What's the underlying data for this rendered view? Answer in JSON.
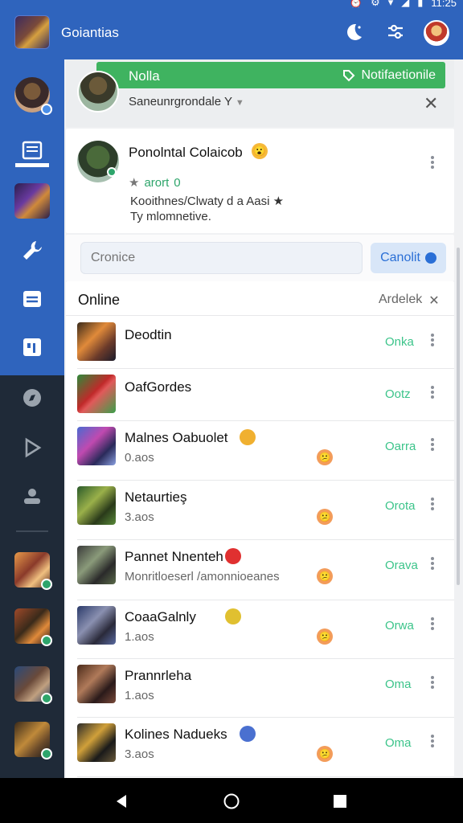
{
  "status_bar": {
    "clock": "11:25"
  },
  "app_bar": {
    "title": "Goiantias"
  },
  "banner": {
    "left": "Nolla",
    "right": "Notifaetionile"
  },
  "header": {
    "server": "Saneunrgrondale",
    "server_caret": "Y"
  },
  "profile": {
    "name": "Ponolntal Colaicob",
    "status_star": "★",
    "status_text": "arort",
    "status_count": "0",
    "bio1": "Kooithnes/Clwaty d a Aasi ★",
    "bio2": "Ty mlomnetive."
  },
  "search": {
    "placeholder": "Cronice"
  },
  "cancel_button": {
    "label": "Canolit"
  },
  "section": {
    "title": "Online",
    "action": "Ardelek"
  },
  "rows": [
    {
      "name": "Deodtin",
      "sub": "",
      "status": "Onka",
      "emoji": ""
    },
    {
      "name": "OafGordes",
      "sub": "",
      "status": "Ootz",
      "emoji": ""
    },
    {
      "name": "Malnes Oabuolet",
      "sub": "0.aos",
      "status": "Oarra",
      "emoji": "😕"
    },
    {
      "name": "Netaurtieş",
      "sub": "3.aos",
      "status": "Orota",
      "emoji": "😕"
    },
    {
      "name": "Pannet Nnenteh",
      "sub": "Monritloeserl /amonnioeanes",
      "status": "Orava",
      "emoji": "😕"
    },
    {
      "name": "CoaaGalnly",
      "sub": "1.aos",
      "status": "Orwa",
      "emoji": "😕"
    },
    {
      "name": "Prannrleha",
      "sub": "1.aos",
      "status": "Oma",
      "emoji": ""
    },
    {
      "name": "Kolines Nadueks",
      "sub": "3.aos",
      "status": "Oma",
      "emoji": "😕"
    }
  ],
  "colors": {
    "primary": "#2f64bd",
    "accent_green": "#3fb360",
    "online": "#3cc48a",
    "sidebar_dark": "#1f2a38"
  }
}
